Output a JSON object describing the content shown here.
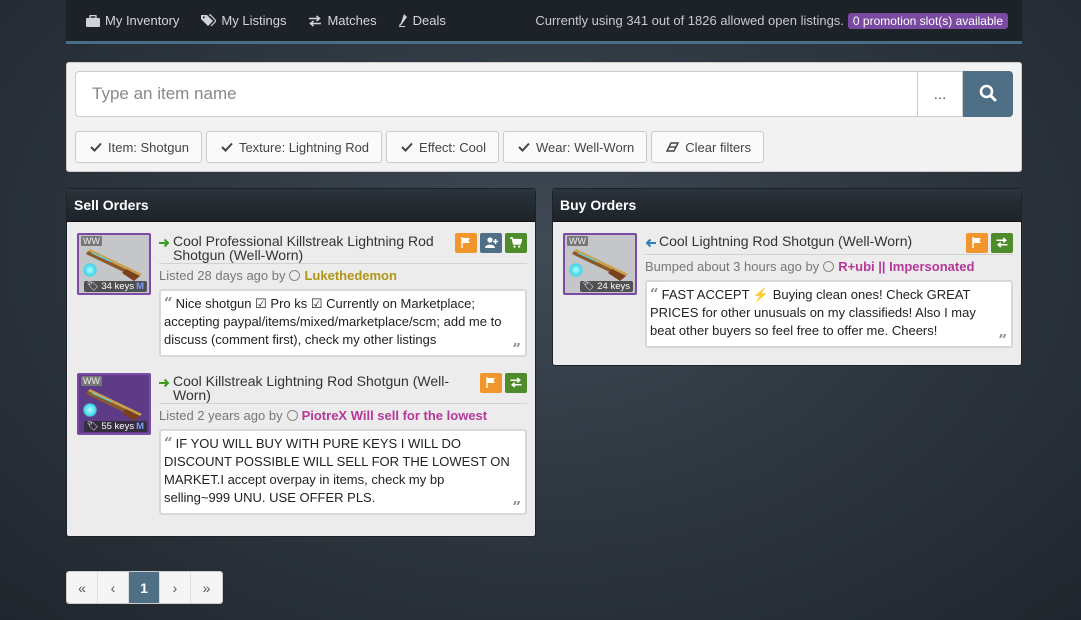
{
  "nav": {
    "items": [
      {
        "label": "My Inventory",
        "icon": "briefcase-icon"
      },
      {
        "label": "My Listings",
        "icon": "tags-icon"
      },
      {
        "label": "Matches",
        "icon": "exchange-icon"
      },
      {
        "label": "Deals",
        "icon": "eyedropper-icon"
      }
    ],
    "usage_text": "Currently using 341 out of 1826 allowed open listings.",
    "promo_badge": "0 promotion slot(s) available"
  },
  "search": {
    "placeholder": "Type an item name",
    "more_label": "...",
    "filters": [
      {
        "label": "Item: Shotgun"
      },
      {
        "label": "Texture: Lightning Rod"
      },
      {
        "label": "Effect: Cool"
      },
      {
        "label": "Wear: Well-Worn"
      }
    ],
    "clear_label": "Clear filters"
  },
  "sell_orders": {
    "heading": "Sell Orders",
    "listings": [
      {
        "title": "Cool Professional Killstreak Lightning Rod Shotgun (Well-Worn)",
        "wear_badge": "WW",
        "price": "34 keys",
        "marker": "M",
        "meta_prefix": "Listed 28 days ago by",
        "user": "Lukethedemon",
        "comment": "Nice shotgun ☑ Pro ks ☑ Currently on Marketplace; accepting paypal/items/mixed/marketplace/scm; add me to discuss (comment first), check my other listings",
        "actions": [
          "flag-icon",
          "add-friend-icon",
          "cart-icon"
        ]
      },
      {
        "title": "Cool Killstreak Lightning Rod Shotgun (Well-Worn)",
        "wear_badge": "WW",
        "price": "55 keys",
        "marker": "M",
        "meta_prefix": "Listed 2 years ago by",
        "user": "PiotreX Will sell for the lowest",
        "comment": "IF YOU WILL BUY WITH PURE KEYS I WILL DO DISCOUNT POSSIBLE WILL SELL FOR THE LOWEST ON MARKET.I accept overpay in items, check my bp selling~999 UNU. USE OFFER PLS.",
        "actions": [
          "flag-icon",
          "exchange-icon"
        ]
      }
    ]
  },
  "buy_orders": {
    "heading": "Buy Orders",
    "listings": [
      {
        "title": "Cool Lightning Rod Shotgun (Well-Worn)",
        "wear_badge": "WW",
        "price": "24 keys",
        "meta_prefix": "Bumped about 3 hours ago by",
        "user": "R+ubi || Impersonated",
        "comment": "FAST ACCEPT ⚡ Buying clean ones! Check GREAT PRICES for other unusuals on my classifieds! Also I may beat other buyers so feel free to offer me. Cheers!",
        "actions": [
          "flag-icon",
          "exchange-icon"
        ]
      }
    ]
  },
  "pagination": {
    "first": "«",
    "prev": "‹",
    "current": "1",
    "next": "›",
    "last": "»"
  },
  "colors": {
    "accent": "#4f6f86",
    "orange": "#f0962c",
    "green": "#4e8b2a",
    "promo": "#7a4aa0",
    "unusual_border": "#7b4aa6",
    "user_gold": "#b29613",
    "user_pink": "#b6379a"
  }
}
